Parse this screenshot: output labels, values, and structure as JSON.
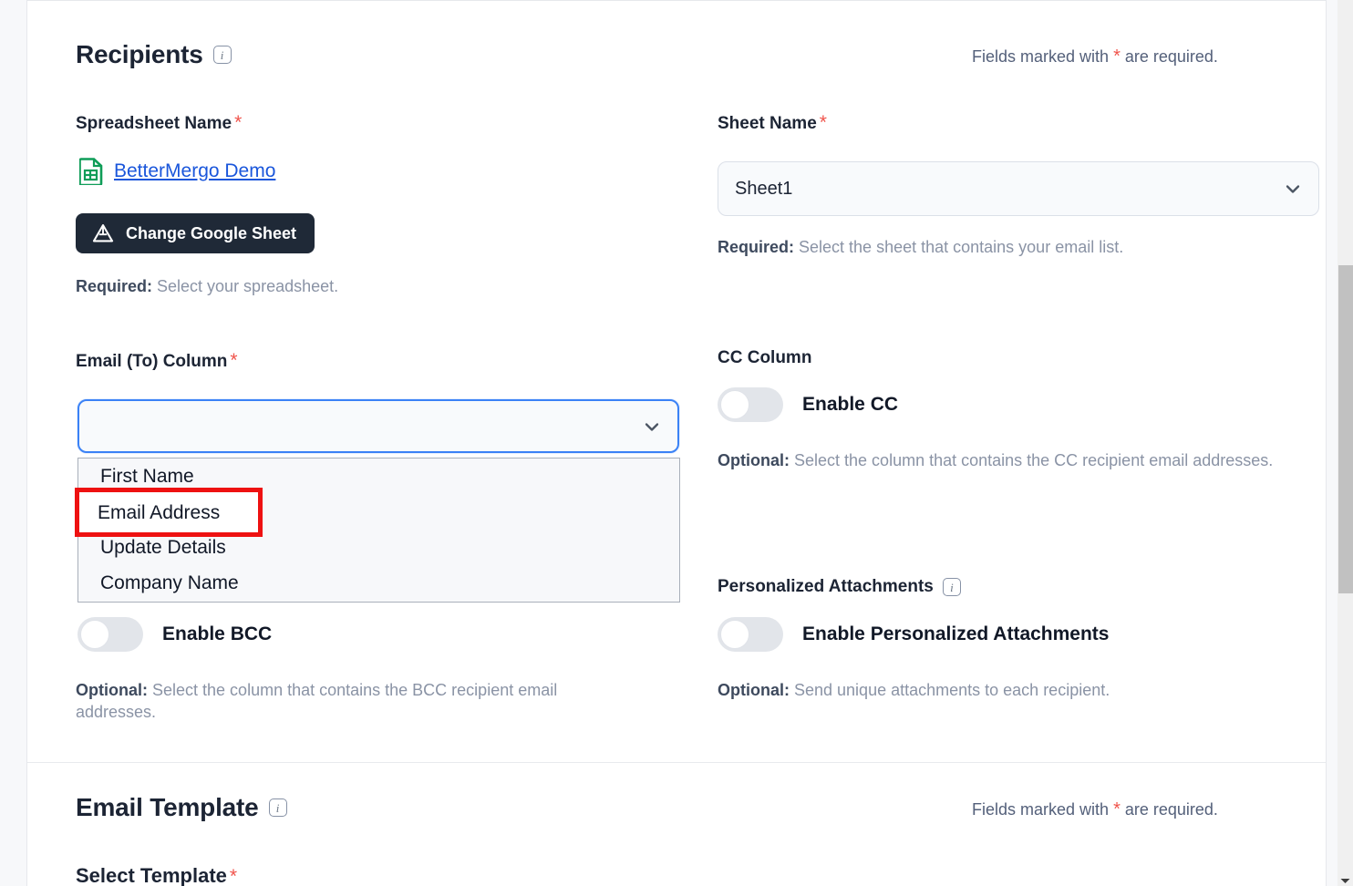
{
  "recipients": {
    "title": "Recipients",
    "info_icon": "info-icon",
    "required_note_prefix": "Fields marked with",
    "required_note_star": "*",
    "required_note_suffix": "are required.",
    "spreadsheet": {
      "label": "Spreadsheet Name",
      "star": "*",
      "link_text": "BetterMergo Demo",
      "link_icon": "google-sheets-icon",
      "button_label": "Change Google Sheet",
      "button_icon": "google-drive-icon",
      "helper_bold": "Required:",
      "helper_text": " Select your spreadsheet."
    },
    "sheet_name": {
      "label": "Sheet Name",
      "star": "*",
      "value": "Sheet1",
      "options": [
        "Sheet1"
      ],
      "helper_bold": "Required:",
      "helper_text": " Select the sheet that contains your email list."
    },
    "email_to_column": {
      "label": "Email (To) Column",
      "star": "*",
      "value": "",
      "placeholder": "",
      "is_open": true,
      "options": [
        "First Name",
        "Email Address",
        "Update Details",
        "Company Name"
      ],
      "highlighted_option": "Email Address",
      "highlight_color": "#ee1111"
    },
    "cc_column": {
      "label": "CC Column",
      "toggle_label": "Enable CC",
      "toggle_state": "off",
      "helper_bold": "Optional:",
      "helper_text": " Select the column that contains the CC recipient email addresses."
    },
    "bcc_column": {
      "toggle_label": "Enable BCC",
      "toggle_state": "off",
      "helper_bold": "Optional:",
      "helper_text": " Select the column that contains the BCC recipient email addresses."
    },
    "personalized_attachments": {
      "label": "Personalized Attachments",
      "info_icon": "info-icon",
      "toggle_label": "Enable Personalized Attachments",
      "toggle_state": "off",
      "helper_bold": "Optional:",
      "helper_text": " Send unique attachments to each recipient."
    }
  },
  "email_template": {
    "title": "Email Template",
    "info_icon": "info-icon",
    "required_note_prefix": "Fields marked with",
    "required_note_star": "*",
    "required_note_suffix": "are required.",
    "select_template": {
      "label": "Select Template",
      "star": "*"
    }
  },
  "colors": {
    "accent_blue": "#3b82f6",
    "link_blue": "#1a56db",
    "required_red": "#f0544c",
    "highlight_red": "#ee1111",
    "dark_button": "#1f2937",
    "sheets_green": "#0f9d58"
  }
}
